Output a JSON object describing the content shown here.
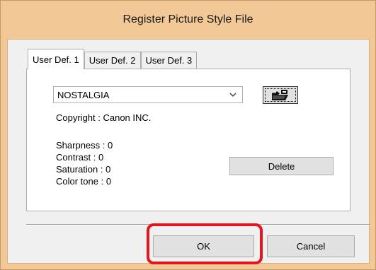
{
  "window": {
    "title": "Register Picture Style File"
  },
  "tabs": [
    {
      "label": "User Def. 1",
      "active": true
    },
    {
      "label": "User Def. 2",
      "active": false
    },
    {
      "label": "User Def. 3",
      "active": false
    }
  ],
  "style_select": {
    "value": "NOSTALGIA"
  },
  "open_button": {
    "icon": "folder-open-icon"
  },
  "copyright": "Copyright : Canon INC.",
  "params": {
    "sharpness": "Sharpness : 0",
    "contrast": "Contrast : 0",
    "saturation": "Saturation : 0",
    "color_tone": "Color tone : 0"
  },
  "buttons": {
    "delete": "Delete",
    "ok": "OK",
    "cancel": "Cancel"
  },
  "colors": {
    "titlebar": "#f2c897",
    "highlight": "#e3161e"
  }
}
